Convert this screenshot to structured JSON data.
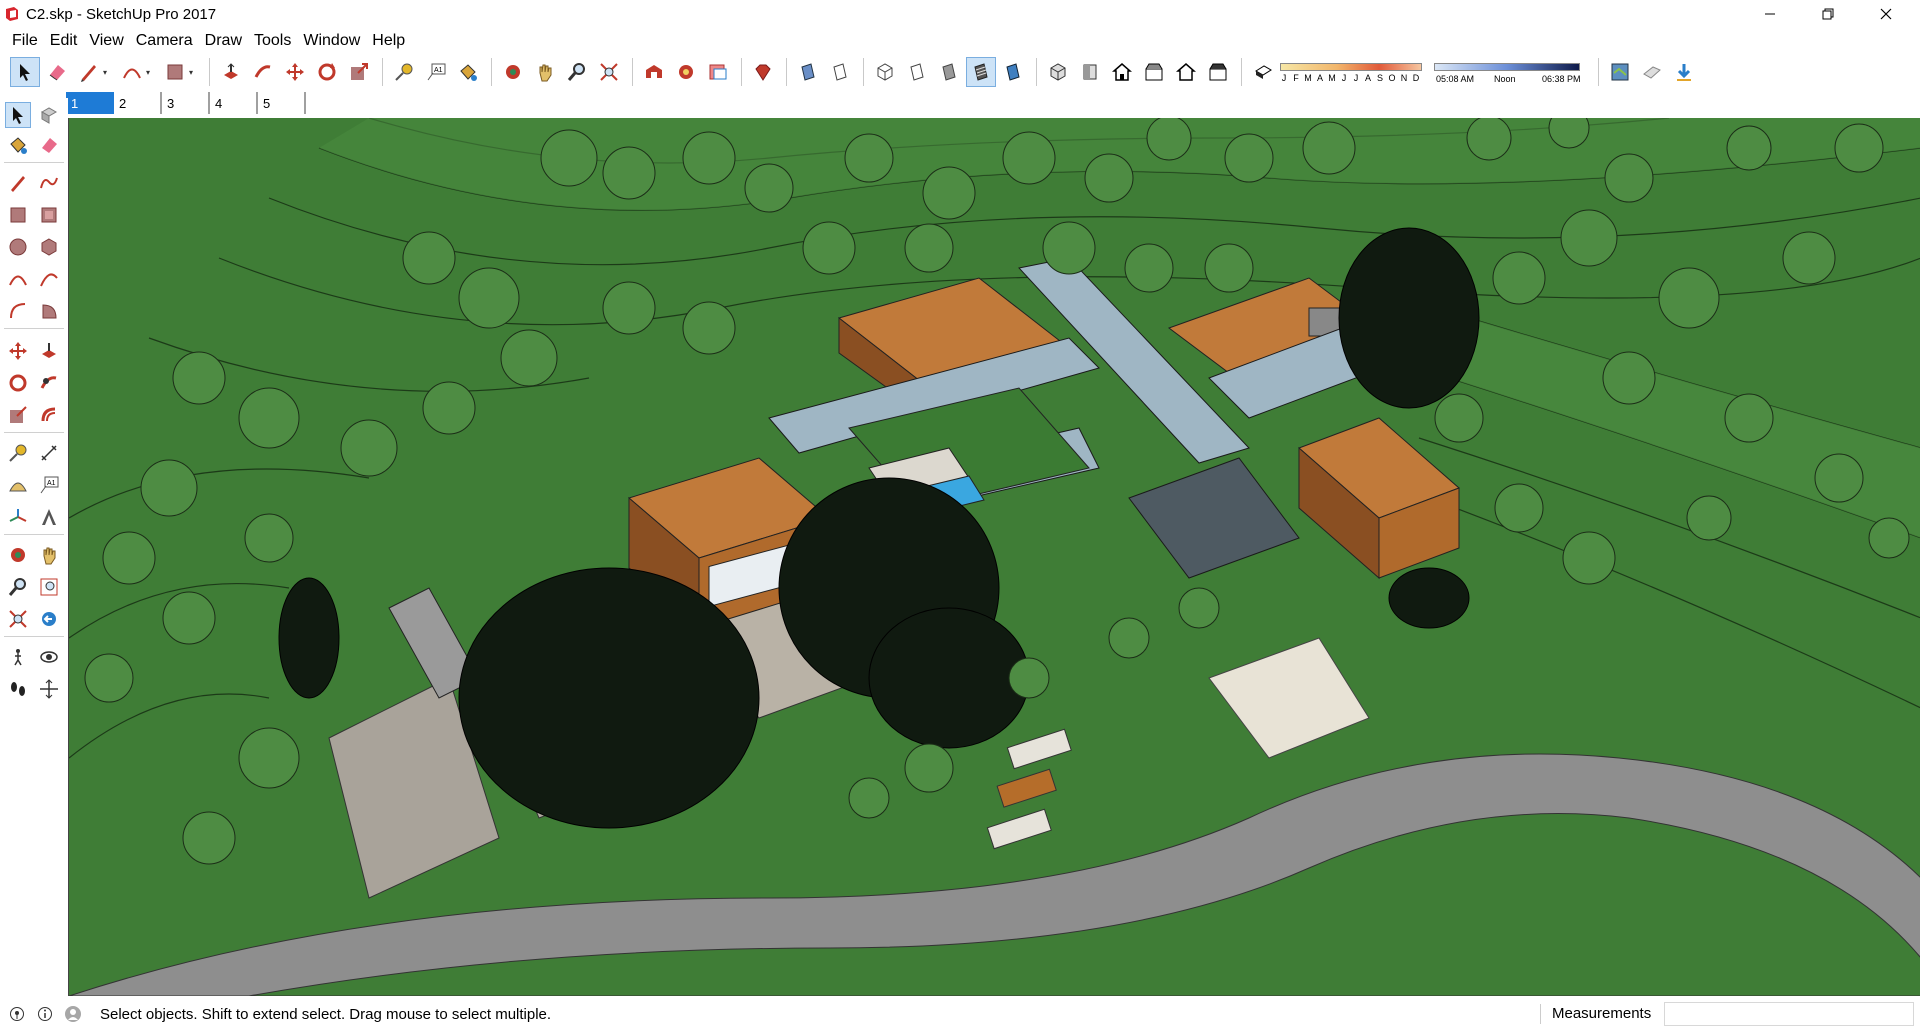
{
  "window": {
    "title": "C2.skp - SketchUp Pro 2017",
    "controls": [
      "minimize-icon",
      "restore-icon",
      "close-icon"
    ]
  },
  "menu": {
    "items": [
      "File",
      "Edit",
      "View",
      "Camera",
      "Draw",
      "Tools",
      "Window",
      "Help"
    ]
  },
  "toolbar": {
    "groups": [
      [
        "select-icon",
        "eraser-icon",
        "pencil-icon",
        "arc-icon",
        "rectangle-icon"
      ],
      [
        "push-pull-icon",
        "follow-me-icon",
        "move-icon",
        "rotate-icon",
        "scale-icon"
      ],
      [
        "tape-measure-icon",
        "text-icon",
        "paint-bucket-icon"
      ],
      [
        "orbit-icon",
        "pan-icon",
        "zoom-icon",
        "zoom-extents-icon"
      ],
      [
        "warehouse-icon",
        "extension-warehouse-icon",
        "layout-icon"
      ],
      [
        "ruby-icon"
      ],
      [
        "xray-icon",
        "wireframe-icon",
        "hidden-line-icon",
        "shaded-icon",
        "shaded-textures-icon",
        "monochrome-icon"
      ],
      [
        "iso-view-icon",
        "top-view-icon",
        "front-view-icon",
        "right-view-icon",
        "back-view-icon",
        "left-view-icon"
      ],
      [
        "shadows-icon"
      ],
      [
        "geo-location-icon",
        "sandbox-icon",
        "download-icon"
      ]
    ]
  },
  "shadows": {
    "months": [
      "J",
      "F",
      "M",
      "A",
      "M",
      "J",
      "J",
      "A",
      "S",
      "O",
      "N",
      "D"
    ],
    "time_start": "05:08 AM",
    "time_mid": "Noon",
    "time_end": "06:38 PM"
  },
  "scenes": {
    "tabs": [
      "1",
      "2",
      "3",
      "4",
      "5"
    ],
    "active": "1"
  },
  "left_palette": {
    "tools": [
      "select-icon",
      "component-icon",
      "paint-bucket-icon",
      "eraser-icon",
      "line-icon",
      "freehand-icon",
      "rectangle-icon",
      "rotated-rectangle-icon",
      "circle-icon",
      "polygon-icon",
      "arc-icon",
      "two-point-arc-icon",
      "three-point-arc-icon",
      "pie-icon",
      "move-icon",
      "push-pull-icon",
      "rotate-icon",
      "follow-me-icon",
      "scale-icon",
      "offset-icon",
      "tape-measure-icon",
      "dimension-icon",
      "protractor-icon",
      "text-icon",
      "axes-icon",
      "3d-text-icon",
      "orbit-icon",
      "pan-icon",
      "zoom-icon",
      "zoom-window-icon",
      "zoom-extents-icon",
      "previous-view-icon",
      "position-camera-icon",
      "look-around-icon",
      "walk-icon",
      "section-plane-icon"
    ]
  },
  "status": {
    "message": "Select objects. Shift to extend select. Drag mouse to select multiple.",
    "measurements_label": "Measurements",
    "measurements_value": ""
  },
  "colors": {
    "grass": "#3e7a35",
    "road": "#8e8e8e",
    "roof": "#c17a3a",
    "accent_tab": "#1e7bd6"
  }
}
